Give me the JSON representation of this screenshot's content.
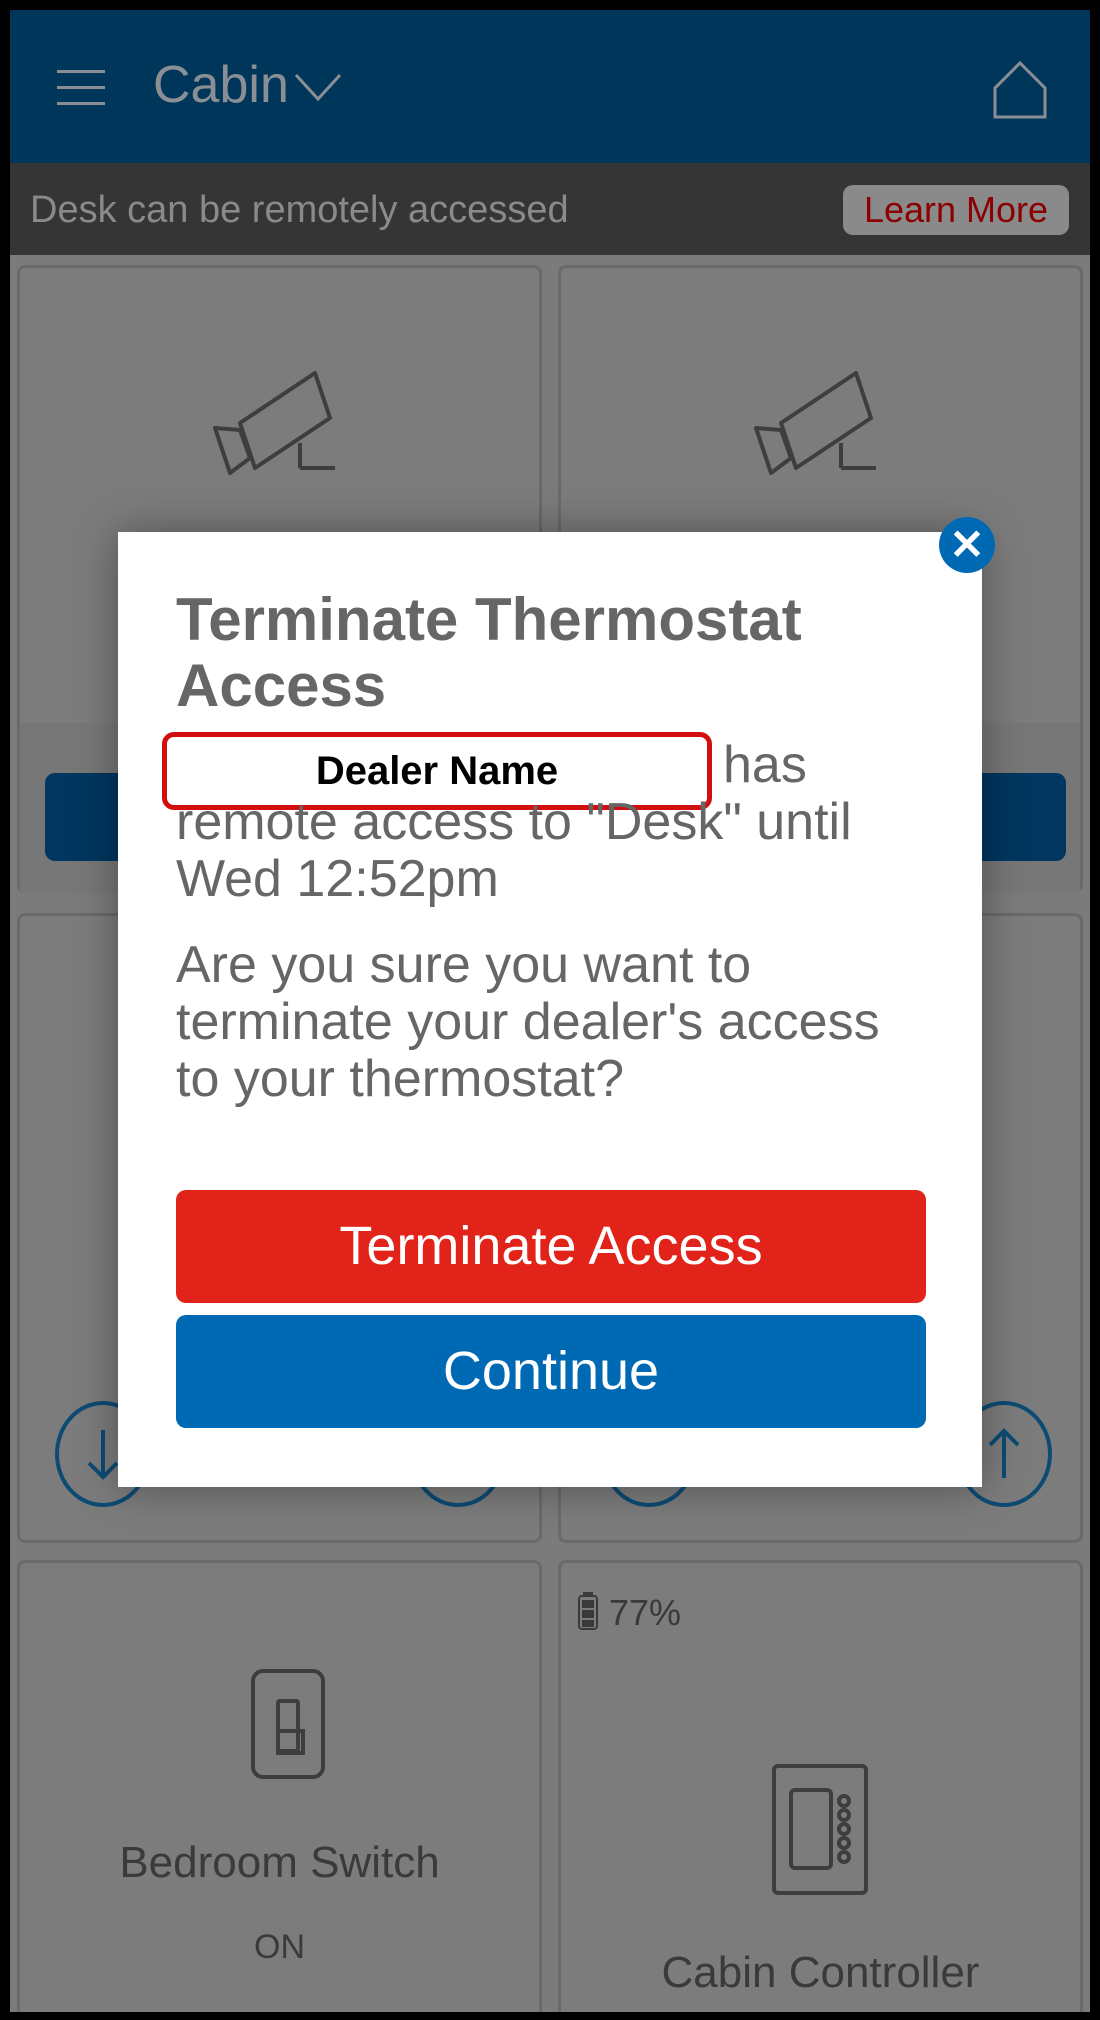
{
  "header": {
    "menu_icon": "hamburger-menu-icon",
    "site_name": "Cabin",
    "site_dropdown_icon": "chevron-down-icon",
    "home_icon": "home-icon"
  },
  "banner": {
    "text": "Desk can be remotely accessed",
    "learn_more_label": "Learn More"
  },
  "tiles": [
    {
      "icon": "security-camera-icon"
    },
    {
      "icon": "security-camera-icon"
    },
    {
      "icon": "thermostat-tile",
      "down_icon": "arrow-down-icon",
      "up_icon": "arrow-up-icon"
    },
    {
      "icon": "thermostat-tile",
      "down_icon": "arrow-down-icon",
      "up_icon": "arrow-up-icon"
    },
    {
      "icon": "light-switch-icon",
      "name": "Bedroom Switch",
      "status": "ON"
    },
    {
      "icon": "controller-panel-icon",
      "name": "Cabin Controller",
      "battery": "77%"
    }
  ],
  "modal": {
    "title": "Terminate Thermostat Access",
    "dealer_name": "Dealer Name",
    "access_line_1": "has",
    "access_line_2": "remote access to \"Desk\" until",
    "access_line_3": "Wed 12:52pm",
    "question": "Are you sure you want to terminate your dealer's access to your thermostat?",
    "terminate_label": "Terminate Access",
    "continue_label": "Continue",
    "close_icon": "close-icon",
    "colors": {
      "terminate": "#e1231a",
      "continue": "#0069b3",
      "highlight": "#d10f0f"
    }
  }
}
